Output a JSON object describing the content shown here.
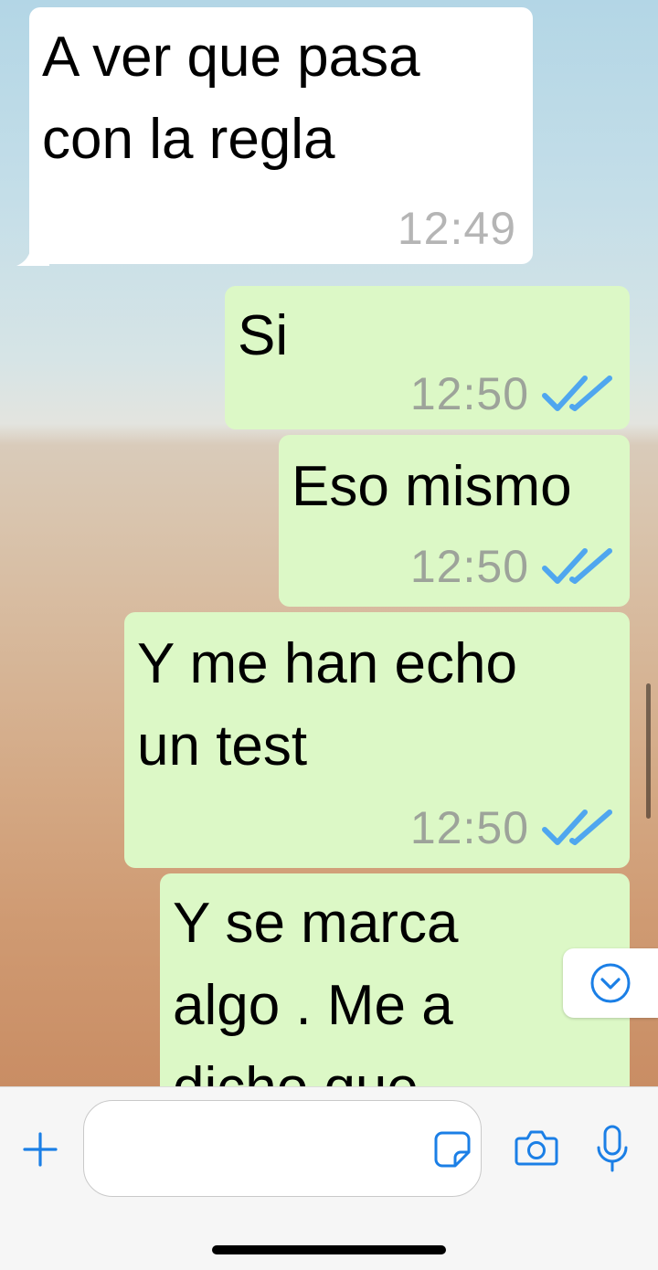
{
  "messages": [
    {
      "direction": "incoming",
      "text": "A ver que pasa con la regla",
      "lines": [
        "A ver que pasa",
        "con la regla"
      ],
      "time": "12:49"
    },
    {
      "direction": "outgoing",
      "text": "Si",
      "time": "12:50",
      "status": "read"
    },
    {
      "direction": "outgoing",
      "text": "Eso mismo",
      "time": "12:50",
      "status": "read"
    },
    {
      "direction": "outgoing",
      "text": "Y me han echo un test",
      "lines": [
        "Y me han echo",
        "un test"
      ],
      "time": "12:50",
      "status": "read"
    },
    {
      "direction": "outgoing",
      "text": "Y se marca algo . Me a dicho que",
      "lines": [
        "Y se marca",
        "algo . Me a",
        "dicho que"
      ]
    }
  ],
  "icons": {
    "read_ticks": "double-check-icon",
    "scroll_down": "chevron-down-circle-icon",
    "add": "plus-icon",
    "sticker": "sticker-icon",
    "camera": "camera-icon",
    "microphone": "microphone-icon"
  },
  "input": {
    "value": "",
    "placeholder": ""
  },
  "colors": {
    "incoming_bubble": "#ffffff",
    "outgoing_bubble": "#dcf8c6",
    "timestamp": "#9da39a",
    "read_ticks": "#4fa6ef",
    "accent": "#1b7fe6"
  }
}
